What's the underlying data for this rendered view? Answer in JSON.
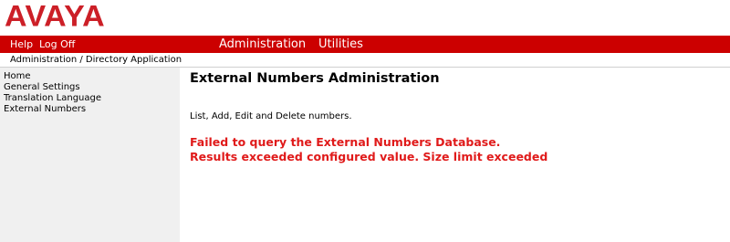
{
  "brand": {
    "logo_text": "AVAYA",
    "accent": "#cc0000"
  },
  "nav": {
    "help": "Help",
    "log_off": "Log Off",
    "administration": "Administration",
    "utilities": "Utilities"
  },
  "breadcrumb": "Administration / Directory Application",
  "sidebar": {
    "items": [
      {
        "label": "Home"
      },
      {
        "label": "General Settings"
      },
      {
        "label": "Translation Language"
      },
      {
        "label": "External Numbers"
      }
    ]
  },
  "main": {
    "title": "External Numbers Administration",
    "description": "List, Add, Edit and Delete numbers.",
    "errors": [
      "Failed to query the External Numbers Database.",
      "Results exceeded configured value. Size limit exceeded"
    ]
  }
}
